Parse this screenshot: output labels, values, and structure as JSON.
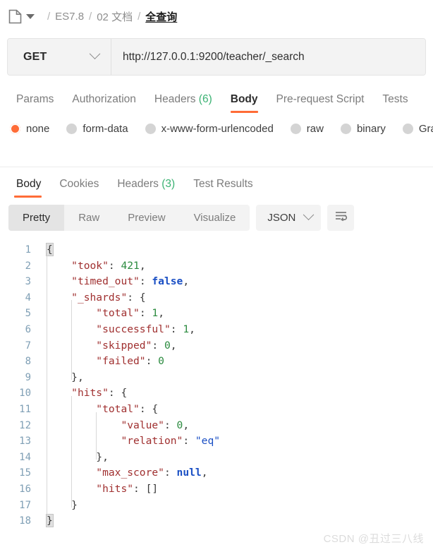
{
  "breadcrumb": {
    "icon": "document-icon",
    "separator": "/",
    "items": [
      {
        "label": "ES7.8",
        "current": false
      },
      {
        "label": "02 文档",
        "current": false
      },
      {
        "label": "全查询",
        "current": true
      }
    ]
  },
  "request": {
    "method": "GET",
    "url": "http://127.0.0.1:9200/teacher/_search",
    "tabs": [
      {
        "label": "Params",
        "count": "",
        "active": false
      },
      {
        "label": "Authorization",
        "count": "",
        "active": false
      },
      {
        "label": "Headers",
        "count": "(6)",
        "active": false
      },
      {
        "label": "Body",
        "count": "",
        "active": true
      },
      {
        "label": "Pre-request Script",
        "count": "",
        "active": false
      },
      {
        "label": "Tests",
        "count": "",
        "active": false
      }
    ],
    "body_types": [
      {
        "label": "none",
        "selected": true
      },
      {
        "label": "form-data",
        "selected": false
      },
      {
        "label": "x-www-form-urlencoded",
        "selected": false
      },
      {
        "label": "raw",
        "selected": false
      },
      {
        "label": "binary",
        "selected": false
      },
      {
        "label": "GraphQL",
        "selected": false
      }
    ]
  },
  "response": {
    "tabs": [
      {
        "label": "Body",
        "count": "",
        "active": true
      },
      {
        "label": "Cookies",
        "count": "",
        "active": false
      },
      {
        "label": "Headers",
        "count": "(3)",
        "active": false
      },
      {
        "label": "Test Results",
        "count": "",
        "active": false
      }
    ],
    "view_modes": [
      {
        "label": "Pretty",
        "active": true
      },
      {
        "label": "Raw",
        "active": false
      },
      {
        "label": "Preview",
        "active": false
      },
      {
        "label": "Visualize",
        "active": false
      }
    ],
    "format": "JSON",
    "wrap_icon": "wrap-text-icon",
    "body_lines": [
      {
        "n": "1",
        "indent": 0,
        "tokens": [
          {
            "t": "{",
            "c": "punct",
            "hl": true
          }
        ]
      },
      {
        "n": "2",
        "indent": 1,
        "tokens": [
          {
            "t": "\"took\"",
            "c": "key"
          },
          {
            "t": ": ",
            "c": "punct"
          },
          {
            "t": "421",
            "c": "num"
          },
          {
            "t": ",",
            "c": "punct"
          }
        ]
      },
      {
        "n": "3",
        "indent": 1,
        "tokens": [
          {
            "t": "\"timed_out\"",
            "c": "key"
          },
          {
            "t": ": ",
            "c": "punct"
          },
          {
            "t": "false",
            "c": "bool"
          },
          {
            "t": ",",
            "c": "punct"
          }
        ]
      },
      {
        "n": "4",
        "indent": 1,
        "tokens": [
          {
            "t": "\"_shards\"",
            "c": "key"
          },
          {
            "t": ": ",
            "c": "punct"
          },
          {
            "t": "{",
            "c": "punct"
          }
        ]
      },
      {
        "n": "5",
        "indent": 2,
        "tokens": [
          {
            "t": "\"total\"",
            "c": "key"
          },
          {
            "t": ": ",
            "c": "punct"
          },
          {
            "t": "1",
            "c": "num"
          },
          {
            "t": ",",
            "c": "punct"
          }
        ]
      },
      {
        "n": "6",
        "indent": 2,
        "tokens": [
          {
            "t": "\"successful\"",
            "c": "key"
          },
          {
            "t": ": ",
            "c": "punct"
          },
          {
            "t": "1",
            "c": "num"
          },
          {
            "t": ",",
            "c": "punct"
          }
        ]
      },
      {
        "n": "7",
        "indent": 2,
        "tokens": [
          {
            "t": "\"skipped\"",
            "c": "key"
          },
          {
            "t": ": ",
            "c": "punct"
          },
          {
            "t": "0",
            "c": "num"
          },
          {
            "t": ",",
            "c": "punct"
          }
        ]
      },
      {
        "n": "8",
        "indent": 2,
        "tokens": [
          {
            "t": "\"failed\"",
            "c": "key"
          },
          {
            "t": ": ",
            "c": "punct"
          },
          {
            "t": "0",
            "c": "num"
          }
        ]
      },
      {
        "n": "9",
        "indent": 1,
        "tokens": [
          {
            "t": "},",
            "c": "punct"
          }
        ]
      },
      {
        "n": "10",
        "indent": 1,
        "tokens": [
          {
            "t": "\"hits\"",
            "c": "key"
          },
          {
            "t": ": ",
            "c": "punct"
          },
          {
            "t": "{",
            "c": "punct"
          }
        ]
      },
      {
        "n": "11",
        "indent": 2,
        "tokens": [
          {
            "t": "\"total\"",
            "c": "key"
          },
          {
            "t": ": ",
            "c": "punct"
          },
          {
            "t": "{",
            "c": "punct"
          }
        ]
      },
      {
        "n": "12",
        "indent": 3,
        "tokens": [
          {
            "t": "\"value\"",
            "c": "key"
          },
          {
            "t": ": ",
            "c": "punct"
          },
          {
            "t": "0",
            "c": "num"
          },
          {
            "t": ",",
            "c": "punct"
          }
        ]
      },
      {
        "n": "13",
        "indent": 3,
        "tokens": [
          {
            "t": "\"relation\"",
            "c": "key"
          },
          {
            "t": ": ",
            "c": "punct"
          },
          {
            "t": "\"eq\"",
            "c": "str"
          }
        ]
      },
      {
        "n": "14",
        "indent": 2,
        "tokens": [
          {
            "t": "},",
            "c": "punct"
          }
        ]
      },
      {
        "n": "15",
        "indent": 2,
        "tokens": [
          {
            "t": "\"max_score\"",
            "c": "key"
          },
          {
            "t": ": ",
            "c": "punct"
          },
          {
            "t": "null",
            "c": "bool"
          },
          {
            "t": ",",
            "c": "punct"
          }
        ]
      },
      {
        "n": "16",
        "indent": 2,
        "tokens": [
          {
            "t": "\"hits\"",
            "c": "key"
          },
          {
            "t": ": ",
            "c": "punct"
          },
          {
            "t": "[]",
            "c": "punct"
          }
        ]
      },
      {
        "n": "17",
        "indent": 1,
        "tokens": [
          {
            "t": "}",
            "c": "punct"
          }
        ]
      },
      {
        "n": "18",
        "indent": 0,
        "tokens": [
          {
            "t": "}",
            "c": "punct",
            "hl": true
          }
        ]
      }
    ]
  },
  "watermark": "CSDN @丑过三八线",
  "colors": {
    "accent": "#ff6c37",
    "count_green": "#3bb273",
    "json_key": "#a03030",
    "json_number": "#2a8a3e",
    "json_keyword": "#1a4fc4",
    "line_number": "#7f9fb5"
  }
}
